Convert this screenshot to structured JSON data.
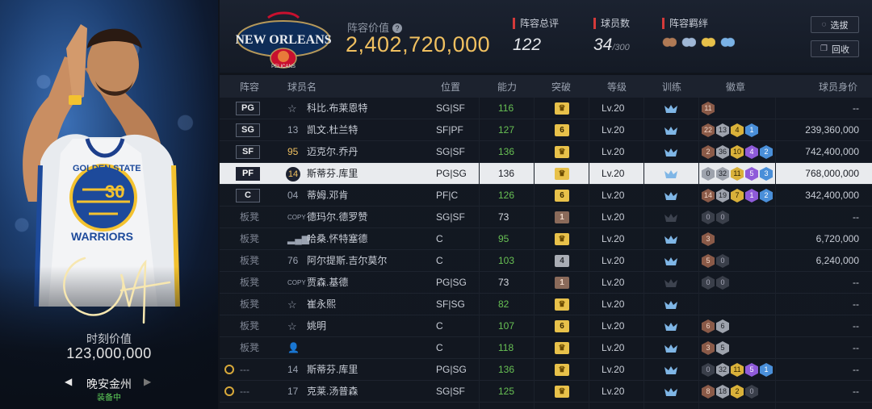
{
  "card": {
    "value_label": "时刻价值",
    "value": "123,000,000",
    "player_name": "晚安金州",
    "status": "装备中",
    "jersey_team": "GOLDEN STATE",
    "jersey_number": "30",
    "jersey_bottom": "WARRIORS",
    "nav_left_icon": "triangle-left-icon",
    "nav_right_icon": "triangle-right-icon"
  },
  "header": {
    "lineup_value_label": "阵容价值",
    "lineup_value": "2,402,720,000",
    "team_logo_text": "NEW ORLEANS",
    "team_logo_sub": "PELICANS",
    "stats": [
      {
        "label": "阵容总评",
        "value": "122",
        "suffix": ""
      },
      {
        "label": "球员数",
        "value": "34",
        "suffix": "/300"
      },
      {
        "label": "阵容羁绊",
        "value": "",
        "suffix": ""
      }
    ],
    "bond_colors": [
      "#b07a55",
      "#9fb7d6",
      "#e8c14a",
      "#7ab2e6"
    ],
    "buttons": {
      "select": "选拔",
      "recycle": "回收"
    }
  },
  "table": {
    "columns": [
      "阵容",
      "球员名",
      "位置",
      "能力",
      "突破",
      "等级",
      "训练",
      "徽章",
      "球员身价"
    ],
    "rows": [
      {
        "slot": "PG",
        "num": "",
        "num_icon": "star-outline-icon",
        "name": "科比.布莱恩特",
        "pos": "SG|SF",
        "ovr": "116",
        "brk": "crown",
        "lv": "Lv.20",
        "train": "blue",
        "badges": [
          [
            "11",
            "bronze"
          ]
        ],
        "price": "--"
      },
      {
        "slot": "SG",
        "num": "13",
        "num_icon": "",
        "name": "凯文.杜兰特",
        "pos": "SF|PF",
        "ovr": "127",
        "brk": "6",
        "lv": "Lv.20",
        "train": "blue",
        "badges": [
          [
            "22",
            "bronze"
          ],
          [
            "13",
            "silver"
          ],
          [
            "4",
            "gold"
          ],
          [
            "1",
            "blue"
          ]
        ],
        "price": "239,360,000"
      },
      {
        "slot": "SF",
        "num": "95",
        "num_icon": "",
        "name": "迈克尔.乔丹",
        "pos": "SG|SF",
        "ovr": "136",
        "brk": "crown",
        "lv": "Lv.20",
        "train": "blue",
        "badges": [
          [
            "2",
            "bronze"
          ],
          [
            "36",
            "silver"
          ],
          [
            "10",
            "gold"
          ],
          [
            "4",
            "purple"
          ],
          [
            "2",
            "blue"
          ]
        ],
        "price": "742,400,000"
      },
      {
        "slot": "PF",
        "num": "14",
        "num_icon": "",
        "name": "斯蒂芬.库里",
        "pos": "PG|SG",
        "ovr": "136",
        "brk": "crown",
        "lv": "Lv.20",
        "train": "blue",
        "badges": [
          [
            "0",
            "silver"
          ],
          [
            "32",
            "silver"
          ],
          [
            "11",
            "gold"
          ],
          [
            "5",
            "purple"
          ],
          [
            "3",
            "blue"
          ]
        ],
        "price": "768,000,000"
      },
      {
        "slot": "C",
        "num": "04",
        "num_icon": "",
        "name": "蒂姆.邓肯",
        "pos": "PF|C",
        "ovr": "126",
        "brk": "6",
        "lv": "Lv.20",
        "train": "blue",
        "badges": [
          [
            "14",
            "bronze"
          ],
          [
            "19",
            "silver"
          ],
          [
            "7",
            "gold"
          ],
          [
            "1",
            "purple"
          ],
          [
            "2",
            "blue"
          ]
        ],
        "price": "342,400,000"
      },
      {
        "slot": "板凳",
        "num": "COPY",
        "num_icon": "",
        "name": "德玛尔.德罗赞",
        "pos": "SG|SF",
        "ovr": "73",
        "brk": "1",
        "lv": "Lv.20",
        "train": "dark",
        "badges": [
          [
            "0",
            "dark"
          ],
          [
            "0",
            "dark"
          ]
        ],
        "price": "--"
      },
      {
        "slot": "板凳",
        "num": "",
        "num_icon": "bars-icon",
        "name": "哈桑.怀特塞德",
        "pos": "C",
        "ovr": "95",
        "brk": "crown",
        "lv": "Lv.20",
        "train": "blue",
        "badges": [
          [
            "3",
            "bronze"
          ]
        ],
        "price": "6,720,000"
      },
      {
        "slot": "板凳",
        "num": "76",
        "num_icon": "",
        "name": "阿尔提斯.吉尔莫尔",
        "pos": "C",
        "ovr": "103",
        "brk": "4",
        "lv": "Lv.20",
        "train": "blue",
        "badges": [
          [
            "5",
            "bronze"
          ],
          [
            "0",
            "dark"
          ]
        ],
        "price": "6,240,000"
      },
      {
        "slot": "板凳",
        "num": "COPY",
        "num_icon": "",
        "name": "贾森.基德",
        "pos": "PG|SG",
        "ovr": "73",
        "brk": "1",
        "lv": "Lv.20",
        "train": "dark",
        "badges": [
          [
            "0",
            "dark"
          ],
          [
            "0",
            "dark"
          ]
        ],
        "price": "--"
      },
      {
        "slot": "板凳",
        "num": "",
        "num_icon": "star-outline-icon",
        "name": "崔永熙",
        "pos": "SF|SG",
        "ovr": "82",
        "brk": "crown",
        "lv": "Lv.20",
        "train": "blue",
        "badges": [],
        "price": "--"
      },
      {
        "slot": "板凳",
        "num": "",
        "num_icon": "star-outline-icon",
        "name": "姚明",
        "pos": "C",
        "ovr": "107",
        "brk": "6",
        "lv": "Lv.20",
        "train": "blue",
        "badges": [
          [
            "6",
            "bronze"
          ],
          [
            "6",
            "silver"
          ]
        ],
        "price": "--"
      },
      {
        "slot": "板凳",
        "num": "",
        "num_icon": "person-icon",
        "name": "",
        "pos": "C",
        "ovr": "118",
        "brk": "crown",
        "lv": "Lv.20",
        "train": "blue",
        "badges": [
          [
            "3",
            "bronze"
          ],
          [
            "5",
            "silver"
          ]
        ],
        "price": "--"
      },
      {
        "slot": "---",
        "num": "14",
        "num_icon": "",
        "name": "斯蒂芬.库里",
        "pos": "PG|SG",
        "ovr": "136",
        "brk": "crown",
        "lv": "Lv.20",
        "train": "blue",
        "badges": [
          [
            "0",
            "dark"
          ],
          [
            "32",
            "silver"
          ],
          [
            "11",
            "gold"
          ],
          [
            "5",
            "purple"
          ],
          [
            "1",
            "blue"
          ]
        ],
        "price": "--",
        "alarm": true
      },
      {
        "slot": "---",
        "num": "17",
        "num_icon": "",
        "name": "克莱.汤普森",
        "pos": "SG|SF",
        "ovr": "125",
        "brk": "crown",
        "lv": "Lv.20",
        "train": "blue",
        "badges": [
          [
            "8",
            "bronze"
          ],
          [
            "18",
            "silver"
          ],
          [
            "2",
            "gold"
          ],
          [
            "0",
            "dark"
          ]
        ],
        "price": "--",
        "alarm": true
      }
    ]
  }
}
